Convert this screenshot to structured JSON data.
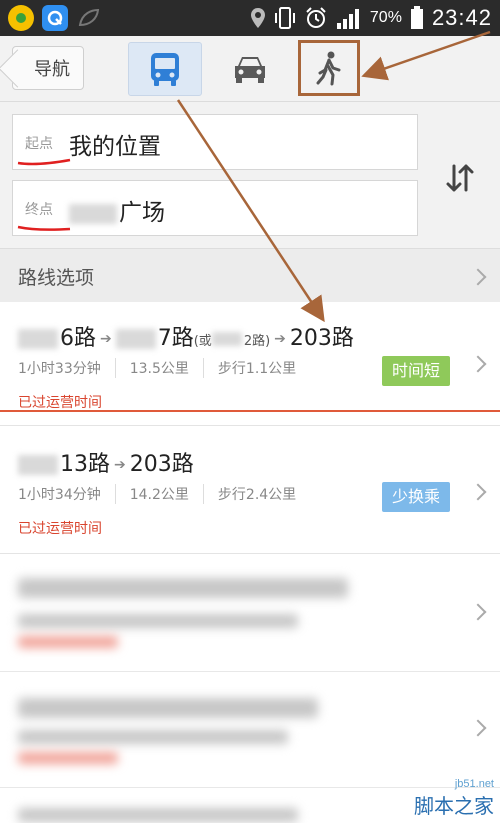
{
  "status_bar": {
    "battery": "70%",
    "time": "23:42"
  },
  "header": {
    "back_label": "导航",
    "modes": [
      "bus-icon",
      "car-icon",
      "walk-icon"
    ],
    "selected_mode": "bus"
  },
  "route_inputs": {
    "start_label": "起点",
    "start_value": "我的位置",
    "end_label": "终点",
    "end_value_suffix": "广场"
  },
  "options": {
    "label": "路线选项"
  },
  "routes": [
    {
      "seg1": "6路",
      "seg2": "7路",
      "seg2_alt": "(或",
      "seg2_alt_tail": "2路)",
      "seg3": "203路",
      "duration": "1小时33分钟",
      "distance": "13.5公里",
      "walk": "步行1.1公里",
      "badge": "时间短",
      "status": "已过运营时间"
    },
    {
      "seg1": "13路",
      "seg2": "203路",
      "duration": "1小时34分钟",
      "distance": "14.2公里",
      "walk": "步行2.4公里",
      "badge": "少换乘",
      "status": "已过运营时间"
    }
  ],
  "watermark": {
    "site": "jb51.net",
    "name": "脚本之家"
  },
  "colors": {
    "annotation": "#a8663a",
    "status_red": "#d9452f",
    "badge_green": "#8fc95a",
    "badge_blue": "#7db9ea",
    "bus_blue": "#2f7fd6"
  }
}
